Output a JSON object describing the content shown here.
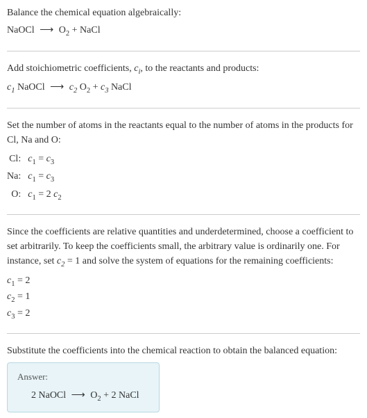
{
  "section1": {
    "text": "Balance the chemical equation algebraically:",
    "eq_lhs": "NaOCl",
    "eq_arrow": "⟶",
    "eq_r1": "O",
    "eq_r1_sub": "2",
    "eq_plus": " + ",
    "eq_r2": "NaCl"
  },
  "section2": {
    "text_a": "Add stoichiometric coefficients, ",
    "ci": "c",
    "ci_sub": "i",
    "text_b": ", to the reactants and products:",
    "c1": "c",
    "c1_sub": "1",
    "sp1": " NaOCl ",
    "arrow": "⟶",
    "c2": " c",
    "c2_sub": "2",
    "sp2": " O",
    "o2_sub": "2",
    "plus": " + ",
    "c3": "c",
    "c3_sub": "3",
    "sp3": " NaCl"
  },
  "section3": {
    "text": "Set the number of atoms in the reactants equal to the number of atoms in the products for Cl, Na and O:",
    "rows": [
      {
        "label": "Cl:",
        "c_a": "c",
        "a_sub": "1",
        "eq": " = ",
        "c_b": "c",
        "b_sub": "3"
      },
      {
        "label": "Na:",
        "c_a": "c",
        "a_sub": "1",
        "eq": " = ",
        "c_b": "c",
        "b_sub": "3"
      },
      {
        "label": "O:",
        "c_a": "c",
        "a_sub": "1",
        "eq": " = 2 ",
        "c_b": "c",
        "b_sub": "2"
      }
    ]
  },
  "section4": {
    "text_a": "Since the coefficients are relative quantities and underdetermined, choose a coefficient to set arbitrarily. To keep the coefficients small, the arbitrary value is ordinarily one. For instance, set ",
    "cv": "c",
    "cv_sub": "2",
    "text_b": " = 1 and solve the system of equations for the remaining coefficients:",
    "lines": [
      {
        "c": "c",
        "sub": "1",
        "val": " = 2"
      },
      {
        "c": "c",
        "sub": "2",
        "val": " = 1"
      },
      {
        "c": "c",
        "sub": "3",
        "val": " = 2"
      }
    ]
  },
  "section5": {
    "text": "Substitute the coefficients into the chemical reaction to obtain the balanced equation:",
    "answer_label": "Answer:",
    "eq_a": "2 NaOCl ",
    "arrow": "⟶",
    "eq_b": " O",
    "o2_sub": "2",
    "eq_c": " + 2 NaCl"
  },
  "chart_data": {
    "type": "table",
    "unbalanced_equation": "NaOCl ⟶ O2 + NaCl",
    "stoichiometric_form": "c1 NaOCl ⟶ c2 O2 + c3 NaCl",
    "atom_balance": [
      {
        "element": "Cl",
        "equation": "c1 = c3"
      },
      {
        "element": "Na",
        "equation": "c1 = c3"
      },
      {
        "element": "O",
        "equation": "c1 = 2 c2"
      }
    ],
    "arbitrary_choice": "c2 = 1",
    "solved_coefficients": {
      "c1": 2,
      "c2": 1,
      "c3": 2
    },
    "balanced_equation": "2 NaOCl ⟶ O2 + 2 NaCl"
  }
}
